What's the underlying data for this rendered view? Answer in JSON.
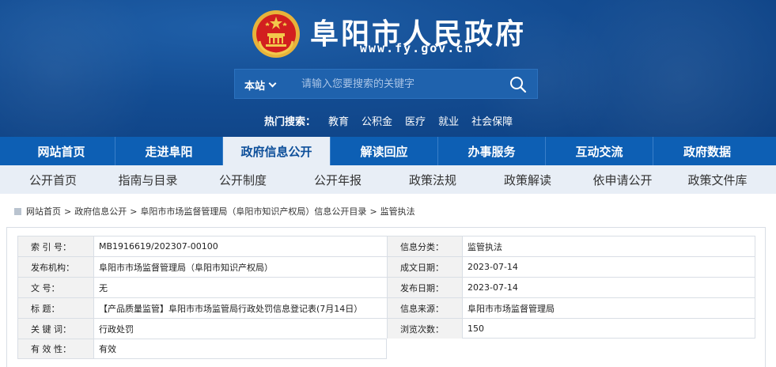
{
  "header": {
    "title": "阜阳市人民政府",
    "url": "www.fy.gov.cn",
    "search": {
      "scope": "本站",
      "placeholder": "请输入您要搜索的关键字"
    },
    "hot": {
      "label": "热门搜索：",
      "keywords": [
        "教育",
        "公积金",
        "医疗",
        "就业",
        "社会保障"
      ]
    }
  },
  "nav": {
    "items": [
      "网站首页",
      "走进阜阳",
      "政府信息公开",
      "解读回应",
      "办事服务",
      "互动交流",
      "政府数据"
    ],
    "active_index": 2
  },
  "subnav": {
    "items": [
      "公开首页",
      "指南与目录",
      "公开制度",
      "公开年报",
      "政策法规",
      "政策解读",
      "依申请公开",
      "政策文件库"
    ]
  },
  "breadcrumb": [
    "网站首页",
    "政府信息公开",
    "阜阳市市场监督管理局（阜阳市知识产权局）信息公开目录",
    "监管执法"
  ],
  "info": {
    "rows": [
      {
        "label": "索  引  号：",
        "value": "MB1916619/202307-00100",
        "label2": "信息分类：",
        "value2": "监管执法"
      },
      {
        "label": "发布机构：",
        "value": "阜阳市市场监督管理局（阜阳市知识产权局）",
        "label2": "成文日期：",
        "value2": "2023-07-14"
      },
      {
        "label": "文      号：",
        "value": "无",
        "label2": "发布日期：",
        "value2": "2023-07-14"
      },
      {
        "label": "标      题：",
        "value": "【产品质量监管】阜阳市市场监管局行政处罚信息登记表(7月14日）",
        "label2": "信息来源：",
        "value2": "阜阳市市场监督管理局"
      },
      {
        "label": "关  键  词：",
        "value": "行政处罚",
        "label2": "浏览次数：",
        "value2": "150"
      },
      {
        "label": "有  效  性：",
        "value": "有效"
      }
    ]
  },
  "colors": {
    "header_bg": "#134c92",
    "nav_bg": "#0d5fb4",
    "subnav_bg": "#e8eef6",
    "label_bg": "#f2f2f2"
  }
}
